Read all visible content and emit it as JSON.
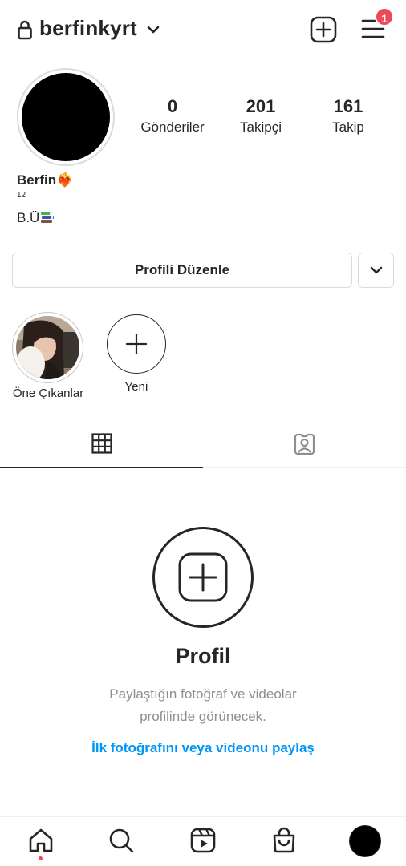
{
  "header": {
    "username": "berfinkyrt",
    "notification_count": "1",
    "icons": [
      "lock-icon",
      "chevron-down-icon",
      "new-post-icon",
      "menu-icon"
    ]
  },
  "profile": {
    "stats": [
      {
        "value": "0",
        "label": "Gönderiler"
      },
      {
        "value": "201",
        "label": "Takipçi"
      },
      {
        "value": "161",
        "label": "Takip"
      }
    ],
    "name": "Berfin❤️‍🔥",
    "age": "12",
    "bio": "B.Ü"
  },
  "actions": {
    "edit_profile_label": "Profili Düzenle"
  },
  "highlights": [
    {
      "label": "Öne Çıkanlar"
    },
    {
      "label": "Yeni"
    }
  ],
  "tabs": [
    "grid-icon",
    "tagged-icon"
  ],
  "empty_state": {
    "title": "Profil",
    "description": "Paylaştığın fotoğraf ve videolar profilinde görünecek.",
    "link": "İlk fotoğrafını veya videonu paylaş"
  },
  "bottom_nav": [
    "home-icon",
    "search-icon",
    "reels-icon",
    "shop-icon",
    "profile-avatar"
  ],
  "colors": {
    "text": "#262626",
    "secondary": "#8e8e8e",
    "link": "#0095f6",
    "badge": "#ed4956",
    "border": "#dbdbdb"
  }
}
